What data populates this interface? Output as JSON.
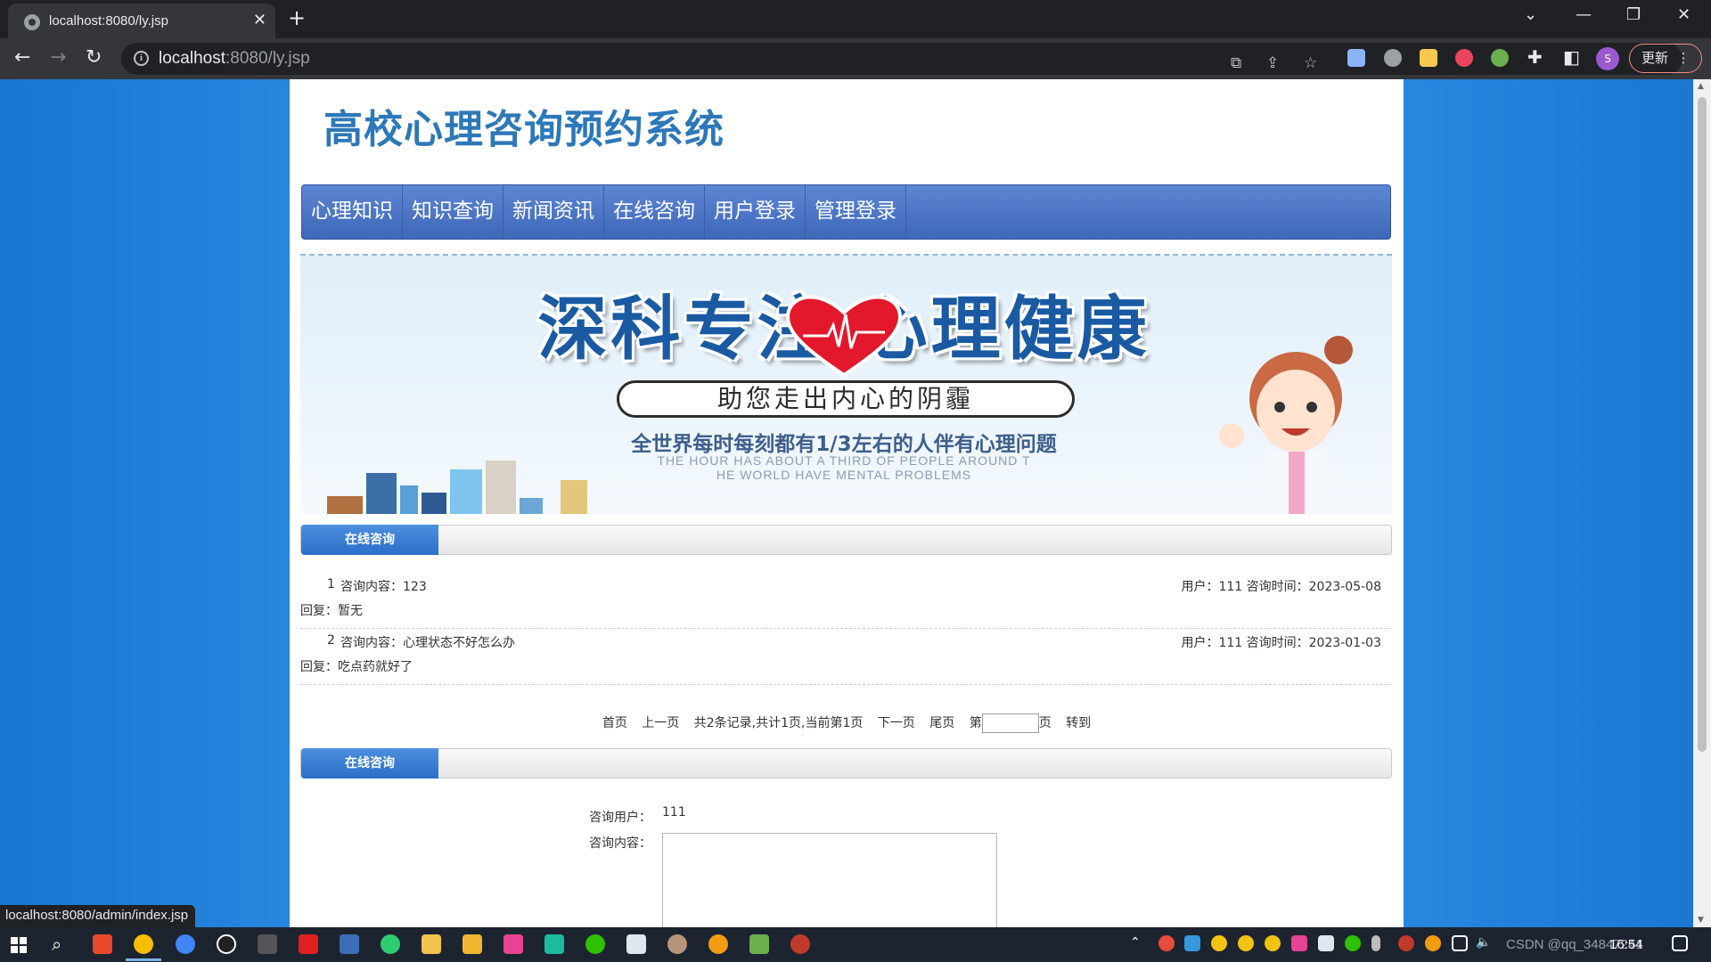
{
  "browser": {
    "tab_title": "localhost:8080/ly.jsp",
    "url_host": "localhost",
    "url_path": ":8080/ly.jsp",
    "update_label": "更新",
    "avatar_letter": "S",
    "status_url": "localhost:8080/admin/index.jsp"
  },
  "site": {
    "title": "高校心理咨询预约系统",
    "menu": [
      "心理知识",
      "知识查询",
      "新闻资讯",
      "在线咨询",
      "用户登录",
      "管理登录"
    ]
  },
  "banner": {
    "headline": "深科专注  心理健康",
    "slogan": "助您走出内心的阴霾",
    "line": "全世界每时每刻都有1/3左右的人伴有心理问题",
    "en_line1": "THE HOUR HAS ABOUT A THIRD OF PEOPLE AROUND T",
    "en_line2": "HE WORLD HAVE MENTAL PROBLEMS"
  },
  "list_section": {
    "title": "在线咨询",
    "messages": [
      {
        "num": "1",
        "content": "咨询内容：123",
        "meta": "用户：111  咨询时间：2023-05-08",
        "reply": "回复：暂无"
      },
      {
        "num": "2",
        "content": "咨询内容：心理状态不好怎么办",
        "meta": "用户：111  咨询时间：2023-01-03",
        "reply": "回复：吃点药就好了"
      }
    ]
  },
  "pager": {
    "first": "首页",
    "prev": "上一页",
    "summary": "共2条记录,共计1页,当前第1页",
    "next": "下一页",
    "last": "尾页",
    "page_prefix": "第",
    "page_suffix": "页",
    "go": "转到",
    "page_value": ""
  },
  "form_section": {
    "title": "在线咨询",
    "user_label": "咨询用户：",
    "user_value": "111",
    "content_label": "咨询内容：",
    "content_value": ""
  },
  "taskbar": {
    "clock": "16:54",
    "watermark": "CSDN @qq_34847241"
  }
}
